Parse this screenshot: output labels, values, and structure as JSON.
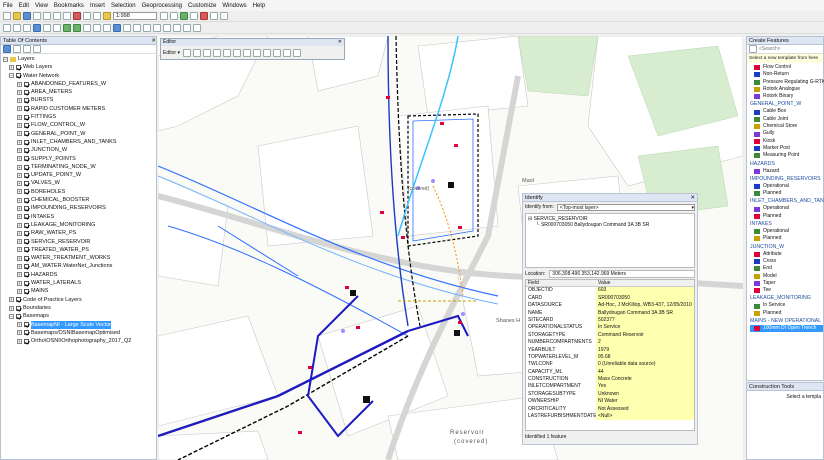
{
  "menu": [
    "File",
    "Edit",
    "View",
    "Bookmarks",
    "Insert",
    "Selection",
    "Geoprocessing",
    "Customize",
    "Windows",
    "Help"
  ],
  "toolbar": {
    "scale": "1:998"
  },
  "toc": {
    "title": "Table Of Contents",
    "root": "Layers",
    "items": [
      {
        "label": "Web Layers",
        "level": 1
      },
      {
        "label": "Water Network",
        "level": 1
      },
      {
        "label": "ABANDONED_FEATURES_W",
        "level": 2
      },
      {
        "label": "AREA_METERS",
        "level": 2
      },
      {
        "label": "BURSTS",
        "level": 2
      },
      {
        "label": "RAPID CUSTOMER METERS",
        "level": 2
      },
      {
        "label": "FITTINGS",
        "level": 2
      },
      {
        "label": "FLOW_CONTROL_W",
        "level": 2
      },
      {
        "label": "GENERAL_POINT_W",
        "level": 2
      },
      {
        "label": "INLET_CHAMBERS_AND_TANKS",
        "level": 2
      },
      {
        "label": "JUNCTION_W",
        "level": 2
      },
      {
        "label": "SUPPLY_POINTS",
        "level": 2
      },
      {
        "label": "TERMINATING_NODE_W",
        "level": 2
      },
      {
        "label": "UPDATE_POINT_W",
        "level": 2
      },
      {
        "label": "VALVES_W",
        "level": 2
      },
      {
        "label": "BOREHOLES",
        "level": 2
      },
      {
        "label": "CHEMICAL_BOOSTER",
        "level": 2
      },
      {
        "label": "IMPOUNDING_RESERVOIRS",
        "level": 2
      },
      {
        "label": "INTAKES",
        "level": 2
      },
      {
        "label": "LEAKAGE_MONITORING",
        "level": 2
      },
      {
        "label": "RAW_WATER_PS",
        "level": 2
      },
      {
        "label": "SERVICE_RESERVOIR",
        "level": 2
      },
      {
        "label": "TREATED_WATER_PS",
        "level": 2
      },
      {
        "label": "WATER_TREATMENT_WORKS",
        "level": 2
      },
      {
        "label": "AM_WATER.WaterNet_Junctions",
        "level": 2
      },
      {
        "label": "HAZARDS",
        "level": 2
      },
      {
        "label": "WATER_LATERALS",
        "level": 2
      },
      {
        "label": "MAINS",
        "level": 2
      },
      {
        "label": "Code of Practice Layers",
        "level": 1
      },
      {
        "label": "Boundaries",
        "level": 1
      },
      {
        "label": "Basemaps",
        "level": 1
      },
      {
        "label": "BasemapNI - Large Scale Vector",
        "level": 2,
        "selected": true
      },
      {
        "label": "Basemaps/OSNIBasemapOptimised",
        "level": 2
      },
      {
        "label": "Ortho\\OSNI\\Orthophotography_2017_Q2",
        "level": 2
      }
    ]
  },
  "editor": {
    "title": "Editor",
    "menu": "Editor ▾"
  },
  "map_labels": {
    "maol": "Maol",
    "shanes": "Shanes H",
    "reservoir": "Reservoir",
    "covered": "(covered)",
    "covered2": "(covered)"
  },
  "identify": {
    "title": "Identify",
    "from_label": "Identify from:",
    "from_value": "<Top-most layer>",
    "tree_root": "SERVICE_RESERVOIR",
    "tree_child": "SR000703050 Ballydougan Command 3A 3B SR",
    "location_label": "Location:",
    "location_value": "306,308.496  353,142.969 Meters",
    "col_field": "Field",
    "col_value": "Value",
    "rows": [
      {
        "f": "OBJECTID",
        "v": "603"
      },
      {
        "f": "CARD",
        "v": "SR000703050"
      },
      {
        "f": "DATASOURCE",
        "v": "Ad-Hoc, J McKillop, WB3-437, 12/05/2010"
      },
      {
        "f": "NAME",
        "v": "Ballydougan Command 3A 3B SR"
      },
      {
        "f": "SITECARD",
        "v": "502377"
      },
      {
        "f": "OPERATIONALSTATUS",
        "v": "In Service"
      },
      {
        "f": "STORAGETYPE",
        "v": "Command Reservoir"
      },
      {
        "f": "NUMBERCOMPARTMENTS",
        "v": "2"
      },
      {
        "f": "YEARBUILT",
        "v": "1979"
      },
      {
        "f": "TOPWATERLEVEL_M",
        "v": "95.68"
      },
      {
        "f": "TWLCONF",
        "v": "0 (Unreliable data source)"
      },
      {
        "f": "CAPACITY_ML",
        "v": "44"
      },
      {
        "f": "CONSTRUCTION",
        "v": "Mass Concrete"
      },
      {
        "f": "INLETCOMPARTMENT",
        "v": "Yes"
      },
      {
        "f": "STORAGESUBTYPE",
        "v": "Unknown"
      },
      {
        "f": "OWNERSHIP",
        "v": "NI Water"
      },
      {
        "f": "ORCRITICALITY",
        "v": "Not Assessed"
      },
      {
        "f": "LASTREFURBISHMENTDATE",
        "v": "<Null>"
      }
    ],
    "footer": "Identified 1 feature"
  },
  "create_features": {
    "title": "Create Features",
    "search_placeholder": "<Search>",
    "info": "Select a new template from here",
    "groups": [
      {
        "type": "item",
        "label": "Flow Control"
      },
      {
        "type": "item",
        "label": "Non-Return"
      },
      {
        "type": "item",
        "label": "Pressure Regulating G-RTK"
      },
      {
        "type": "item",
        "label": "Rotork Analogue"
      },
      {
        "type": "item",
        "label": "Rotork Binary"
      },
      {
        "type": "head",
        "label": "GENERAL_POINT_W"
      },
      {
        "type": "item",
        "label": "Cable Box"
      },
      {
        "type": "item",
        "label": "Cable Joint"
      },
      {
        "type": "item",
        "label": "Chemical Store"
      },
      {
        "type": "item",
        "label": "Gully"
      },
      {
        "type": "item",
        "label": "Kiosk"
      },
      {
        "type": "item",
        "label": "Marker Post"
      },
      {
        "type": "item",
        "label": "Measuring Point"
      },
      {
        "type": "head",
        "label": "HAZARDS"
      },
      {
        "type": "item",
        "label": "Hazard"
      },
      {
        "type": "head",
        "label": "IMPOUNDING_RESERVOIRS"
      },
      {
        "type": "item",
        "label": "Operational"
      },
      {
        "type": "item",
        "label": "Planned"
      },
      {
        "type": "head",
        "label": "INLET_CHAMBERS_AND_TANKS"
      },
      {
        "type": "item",
        "label": "Operational"
      },
      {
        "type": "item",
        "label": "Planned"
      },
      {
        "type": "head",
        "label": "INTAKES"
      },
      {
        "type": "item",
        "label": "Operational"
      },
      {
        "type": "item",
        "label": "Planned"
      },
      {
        "type": "head",
        "label": "JUNCTION_W"
      },
      {
        "type": "item",
        "label": "Attribute"
      },
      {
        "type": "item",
        "label": "Cross"
      },
      {
        "type": "item",
        "label": "End"
      },
      {
        "type": "item",
        "label": "Model"
      },
      {
        "type": "item",
        "label": "Taper"
      },
      {
        "type": "item",
        "label": "Tee"
      },
      {
        "type": "head",
        "label": "LEAKAGE_MONITORING"
      },
      {
        "type": "item",
        "label": "In Service"
      },
      {
        "type": "item",
        "label": "Planned"
      },
      {
        "type": "head",
        "label": "MAINS - NEW OPERATIONAL"
      },
      {
        "type": "item",
        "label": "100mm DI Open Trench",
        "selected": true
      }
    ],
    "construction_tools": "Construction Tools",
    "construction_hint": "Select a templa"
  }
}
